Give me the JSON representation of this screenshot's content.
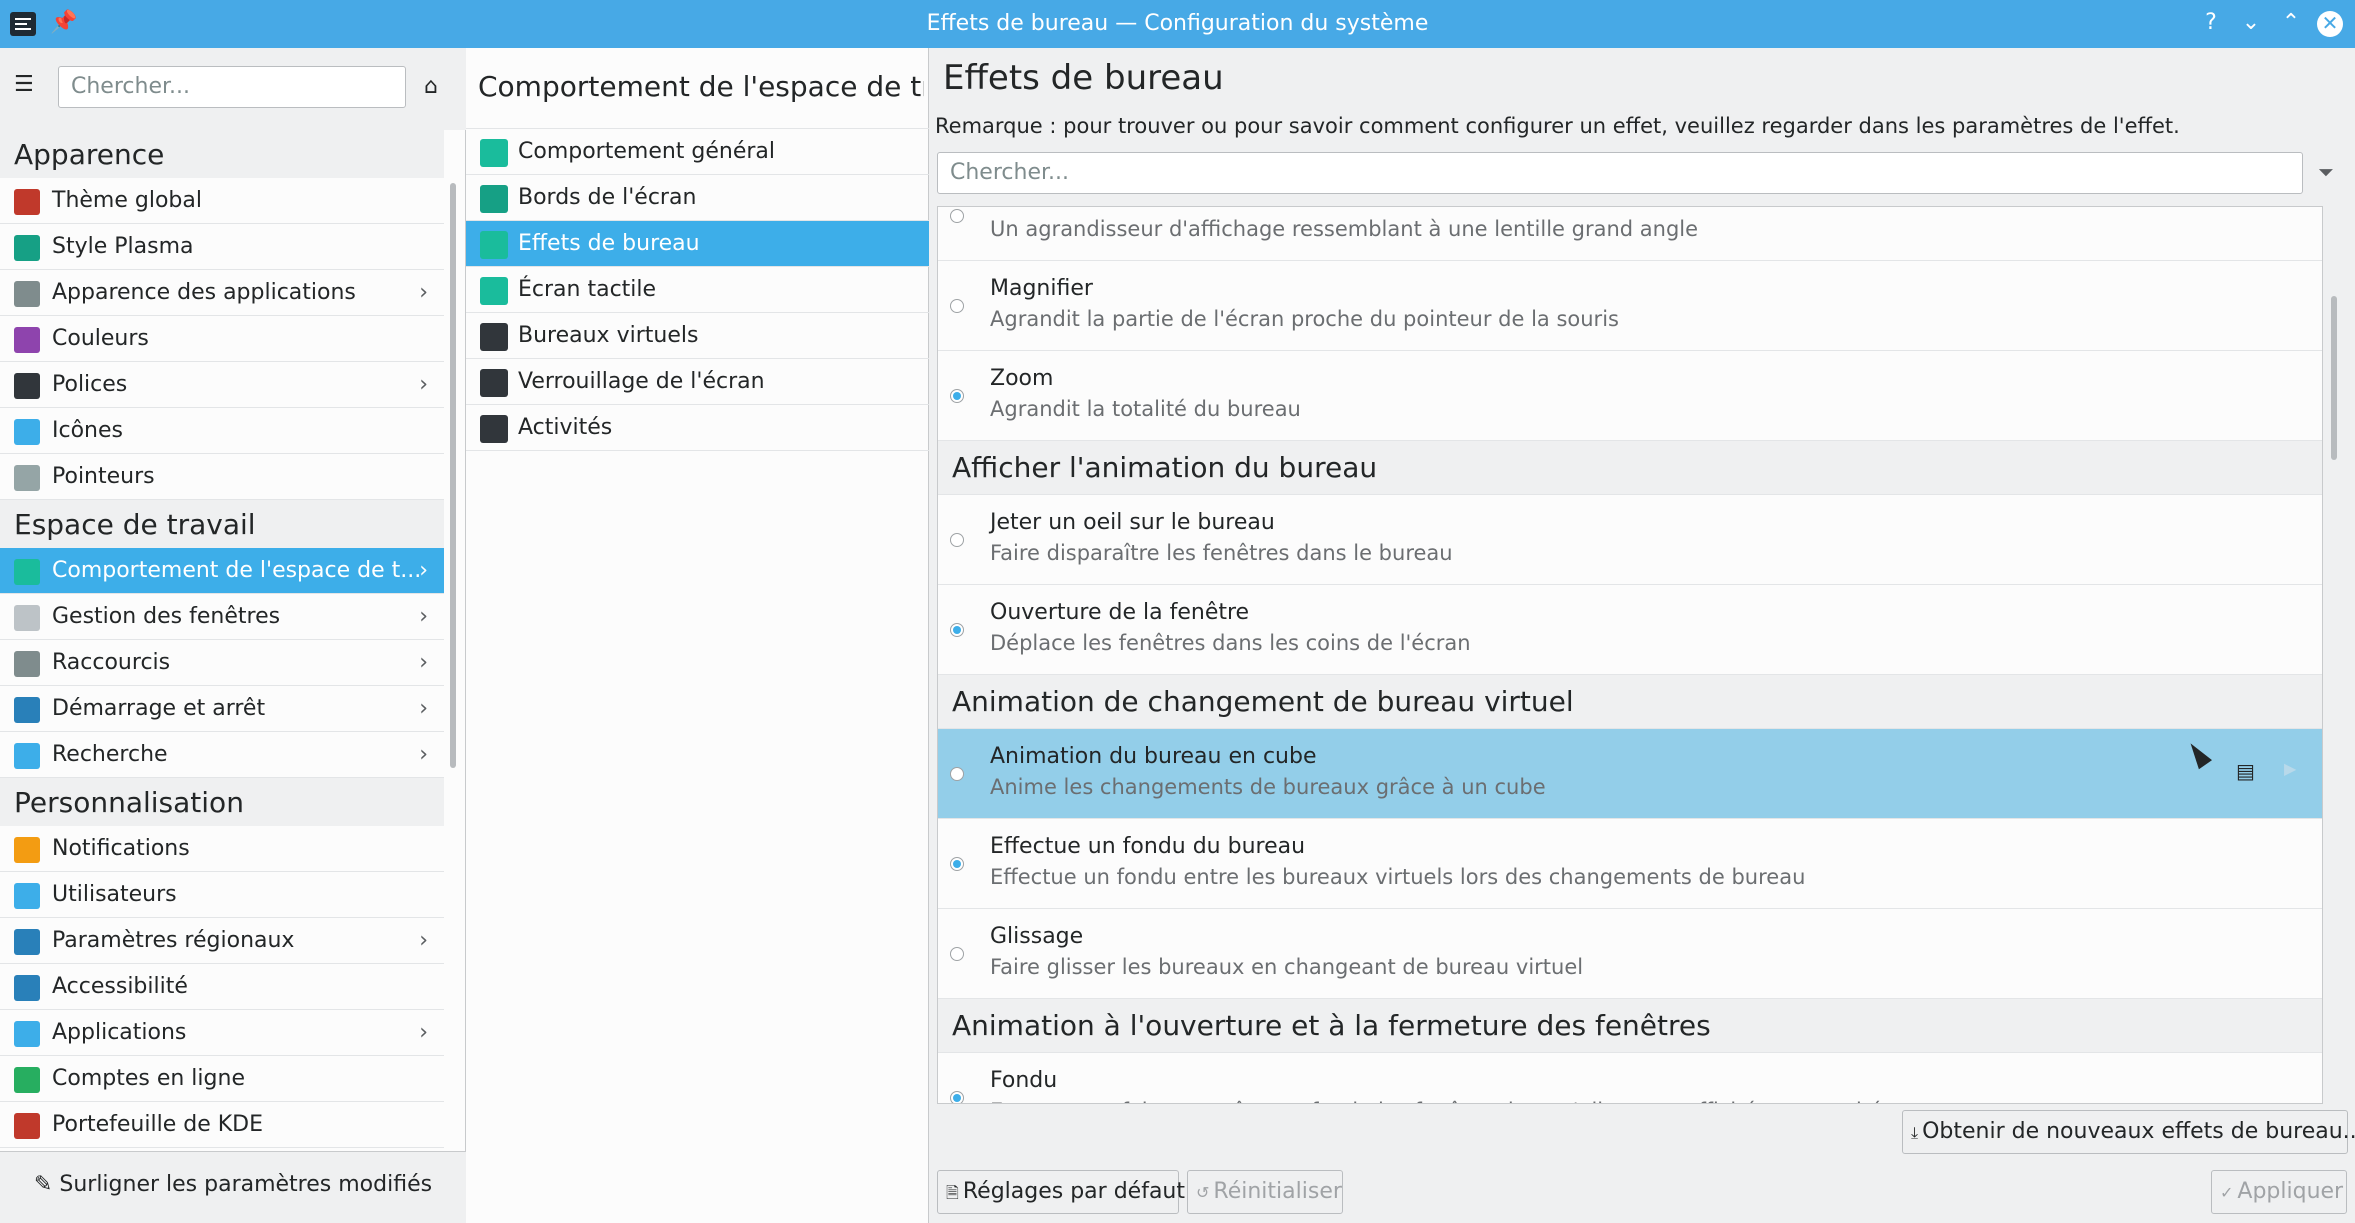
{
  "window": {
    "title": "Effets de bureau — Configuration du système",
    "buttons": {
      "help": "?",
      "minimize": "⌄",
      "maximize": "⌃",
      "close": "✕"
    }
  },
  "sidebar": {
    "search_placeholder": "Chercher...",
    "sections": [
      {
        "title": "Apparence",
        "items": [
          {
            "label": "Thème global",
            "icon": "global-theme-icon",
            "color": "#c0392b",
            "chevron": false
          },
          {
            "label": "Style Plasma",
            "icon": "plasma-style-icon",
            "color": "#16a085",
            "chevron": false
          },
          {
            "label": "Apparence des applications",
            "icon": "app-style-icon",
            "color": "#7f8c8d",
            "chevron": true
          },
          {
            "label": "Couleurs",
            "icon": "colors-icon",
            "color": "#8e44ad",
            "chevron": false
          },
          {
            "label": "Polices",
            "icon": "fonts-icon",
            "color": "#31363b",
            "chevron": true
          },
          {
            "label": "Icônes",
            "icon": "icons-icon",
            "color": "#3daee9",
            "chevron": false
          },
          {
            "label": "Pointeurs",
            "icon": "cursors-icon",
            "color": "#95a5a6",
            "chevron": false
          }
        ]
      },
      {
        "title": "Espace de travail",
        "items": [
          {
            "label": "Comportement de l'espace de t...",
            "icon": "workspace-behavior-icon",
            "color": "#1abc9c",
            "chevron": true,
            "selected": true
          },
          {
            "label": "Gestion des fenêtres",
            "icon": "window-management-icon",
            "color": "#bdc3c7",
            "chevron": true
          },
          {
            "label": "Raccourcis",
            "icon": "shortcuts-icon",
            "color": "#7f8c8d",
            "chevron": true
          },
          {
            "label": "Démarrage et arrêt",
            "icon": "startup-shutdown-icon",
            "color": "#2980b9",
            "chevron": true
          },
          {
            "label": "Recherche",
            "icon": "search-icon",
            "color": "#3daee9",
            "chevron": true
          }
        ]
      },
      {
        "title": "Personnalisation",
        "items": [
          {
            "label": "Notifications",
            "icon": "bell-icon",
            "color": "#f39c12",
            "chevron": false
          },
          {
            "label": "Utilisateurs",
            "icon": "users-icon",
            "color": "#3daee9",
            "chevron": false
          },
          {
            "label": "Paramètres régionaux",
            "icon": "regional-settings-icon",
            "color": "#2980b9",
            "chevron": true
          },
          {
            "label": "Accessibilité",
            "icon": "accessibility-icon",
            "color": "#2980b9",
            "chevron": false
          },
          {
            "label": "Applications",
            "icon": "applications-icon",
            "color": "#3daee9",
            "chevron": true
          },
          {
            "label": "Comptes en ligne",
            "icon": "online-accounts-icon",
            "color": "#27ae60",
            "chevron": false
          },
          {
            "label": "Portefeuille de KDE",
            "icon": "kde-wallet-icon",
            "color": "#c0392b",
            "chevron": false
          }
        ]
      }
    ],
    "highlight_button": "Surligner les paramètres modifiés"
  },
  "middle": {
    "title": "Comportement de l'espace de tra...",
    "items": [
      {
        "label": "Comportement général",
        "icon": "general-behavior-icon",
        "color": "#1abc9c"
      },
      {
        "label": "Bords de l'écran",
        "icon": "screen-edges-icon",
        "color": "#16a085"
      },
      {
        "label": "Effets de bureau",
        "icon": "desktop-effects-icon",
        "color": "#1abc9c",
        "selected": true
      },
      {
        "label": "Écran tactile",
        "icon": "touchscreen-icon",
        "color": "#1abc9c"
      },
      {
        "label": "Bureaux virtuels",
        "icon": "virtual-desktops-icon",
        "color": "#31363b"
      },
      {
        "label": "Verrouillage de l'écran",
        "icon": "screen-lock-icon",
        "color": "#31363b"
      },
      {
        "label": "Activités",
        "icon": "activities-icon",
        "color": "#31363b"
      }
    ]
  },
  "main": {
    "title": "Effets de bureau",
    "note": "Remarque : pour trouver ou pour savoir comment configurer un effet, veuillez regarder dans les paramètres de l'effet.",
    "search_placeholder": "Chercher...",
    "entries": [
      {
        "type": "effect",
        "name": "",
        "desc": "Un agrandisseur d'affichage ressemblant à une lentille grand angle",
        "on": false
      },
      {
        "type": "effect",
        "name": "Magnifier",
        "desc": "Agrandit la partie de l'écran proche du pointeur de la souris",
        "on": false
      },
      {
        "type": "effect",
        "name": "Zoom",
        "desc": "Agrandit la totalité du bureau",
        "on": true
      },
      {
        "type": "category",
        "name": "Afficher l'animation du bureau"
      },
      {
        "type": "effect",
        "name": "Jeter un oeil sur le bureau",
        "desc": "Faire disparaître les fenêtres dans le bureau",
        "on": false
      },
      {
        "type": "effect",
        "name": "Ouverture de la fenêtre",
        "desc": "Déplace les fenêtres dans les coins de l'écran",
        "on": true
      },
      {
        "type": "category",
        "name": "Animation de changement de bureau virtuel"
      },
      {
        "type": "effect",
        "name": "Animation du bureau en cube",
        "desc": "Anime les changements de bureaux grâce à un cube",
        "on": false,
        "hover": true
      },
      {
        "type": "effect",
        "name": "Effectue un fondu du bureau",
        "desc": "Effectue un fondu entre les bureaux virtuels lors des changements de bureau",
        "on": true
      },
      {
        "type": "effect",
        "name": "Glissage",
        "desc": "Faire glisser les bureaux en changeant de bureau virtuel",
        "on": false
      },
      {
        "type": "category",
        "name": "Animation à l'ouverture et à la fermeture des fenêtres"
      },
      {
        "type": "effect",
        "name": "Fondu",
        "desc": "Estompe ou fait apparaître en fondu les fenêtres lorsqu'elles sont affichées ou cachées",
        "on": true
      }
    ],
    "get_new": "Obtenir de nouveaux effets de bureau...",
    "defaults": "Réglages par défaut",
    "reset": "Réinitialiser",
    "apply": "Appliquer"
  }
}
